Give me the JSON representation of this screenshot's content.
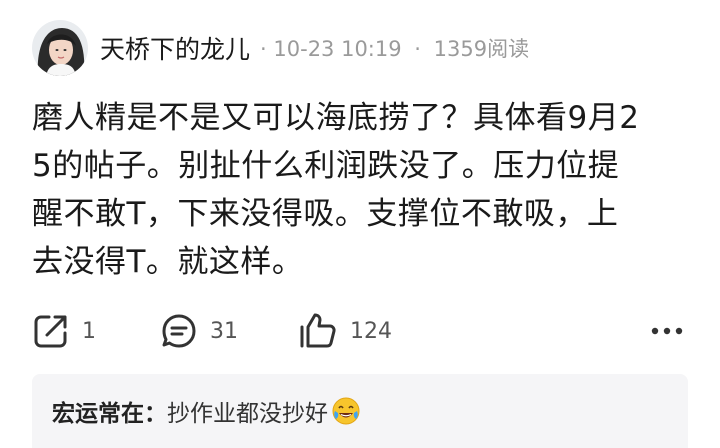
{
  "post": {
    "author": "天桥下的龙儿",
    "date": "10-23 10:19",
    "separator": "·",
    "views": "1359阅读",
    "content_lines": [
      "磨人精是不是又可以海底捞了？具体看9月2",
      "5的帖子。别扯什么利润跌没了。压力位提",
      "醒不敢T，下来没得吸。支撑位不敢吸，上",
      "去没得T。就这样。"
    ]
  },
  "actions": {
    "share_count": "1",
    "comment_count": "31",
    "like_count": "124"
  },
  "comment_preview": {
    "name": "宏运常在：",
    "text": "抄作业都没抄好",
    "emoji": "crying-laughing-emoji"
  },
  "icons": {
    "share": "share-icon",
    "comment": "comment-icon",
    "like": "thumbs-up-icon",
    "more": "more-icon"
  },
  "colors": {
    "text": "#1a1a1a",
    "meta": "#9a9a9a",
    "count": "#555555",
    "comment_bg": "#f5f5f7"
  }
}
